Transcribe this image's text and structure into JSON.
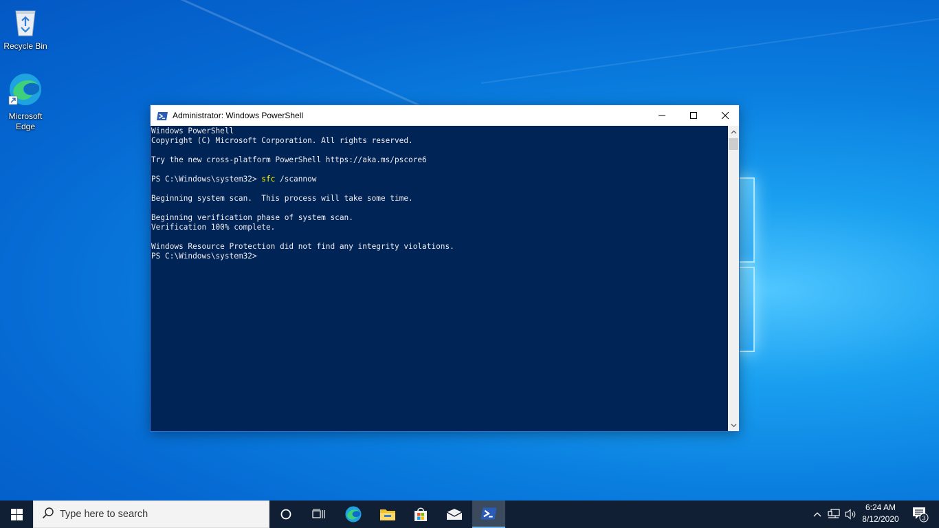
{
  "desktop": {
    "icons": [
      {
        "label": "Recycle Bin",
        "icon": "recycle-bin-icon"
      },
      {
        "label": "Microsoft Edge",
        "icon": "edge-icon"
      }
    ]
  },
  "window": {
    "title": "Administrator: Windows PowerShell",
    "icon": "powershell-icon",
    "controls": [
      "minimize",
      "maximize",
      "close"
    ],
    "console_lines": [
      "Windows PowerShell",
      "Copyright (C) Microsoft Corporation. All rights reserved.",
      "",
      "Try the new cross-platform PowerShell https://aka.ms/pscore6",
      "",
      "PS C:\\Windows\\system32> ",
      "",
      "Beginning system scan.  This process will take some time.",
      "",
      "Beginning verification phase of system scan.",
      "Verification 100% complete.",
      "",
      "Windows Resource Protection did not find any integrity violations.",
      "PS C:\\Windows\\system32>"
    ],
    "command": {
      "name": "sfc",
      "args": " /scannow"
    },
    "colors": {
      "console_bg": "#012456",
      "console_text": "#eeedf0",
      "command_text": "#ffff00"
    }
  },
  "taskbar": {
    "search_placeholder": "Type here to search",
    "pinned": [
      "cortana-icon",
      "task-view-icon",
      "edge-icon",
      "file-explorer-icon",
      "store-icon",
      "mail-icon",
      "powershell-icon"
    ],
    "tray": {
      "time": "6:24 AM",
      "date": "8/12/2020",
      "notifications": "3"
    },
    "colors": {
      "bg": "#101f33"
    }
  }
}
